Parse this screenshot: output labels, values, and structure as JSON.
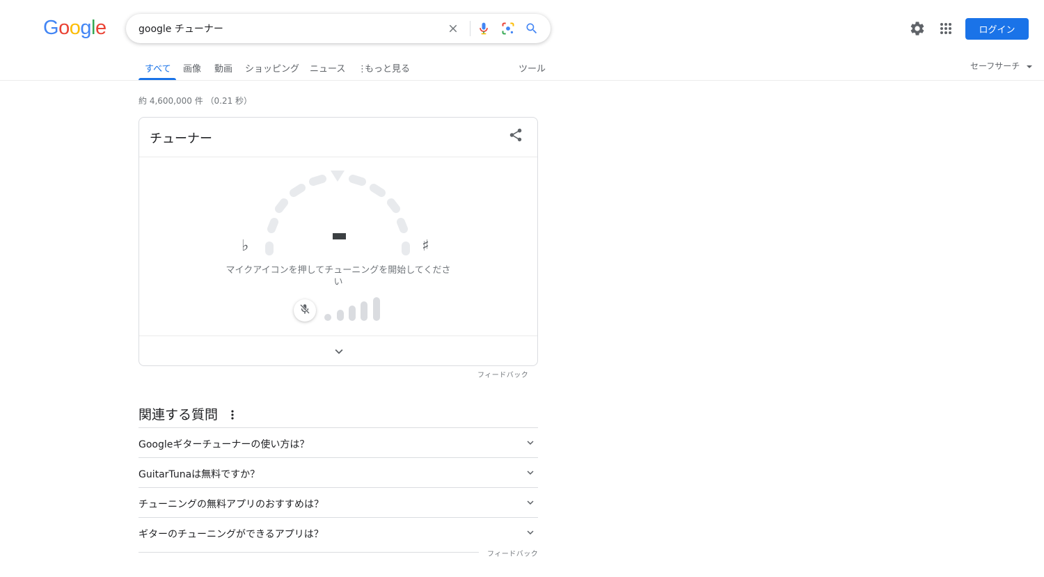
{
  "logo": {
    "letters": [
      {
        "ch": "G",
        "color": "#4285f4"
      },
      {
        "ch": "o",
        "color": "#ea4335"
      },
      {
        "ch": "o",
        "color": "#fbbc05"
      },
      {
        "ch": "g",
        "color": "#4285f4"
      },
      {
        "ch": "l",
        "color": "#34a853"
      },
      {
        "ch": "e",
        "color": "#ea4335"
      }
    ]
  },
  "search": {
    "value": "google チューナー",
    "clear_icon": "close-icon",
    "voice_icon": "mic-icon",
    "lens_icon": "lens-icon",
    "search_icon": "search-icon"
  },
  "header": {
    "settings_icon": "gear-icon",
    "apps_icon": "apps-grid-icon",
    "login_label": "ログイン"
  },
  "tabs": {
    "all": "すべて",
    "images": "画像",
    "videos": "動画",
    "shopping": "ショッピング",
    "news": "ニュース",
    "more": "もっと見る",
    "tools": "ツール",
    "safesearch": "セーフサーチ"
  },
  "result_stats": "約 4,600,000 件 （0.21 秒）",
  "tuner": {
    "title": "チューナー",
    "flat_symbol": "♭",
    "sharp_symbol": "♯",
    "note": "",
    "message": "マイクアイコンを押してチューニングを開始してください",
    "feedback": "フィードバック"
  },
  "paa": {
    "title": "関連する質問",
    "questions": [
      "Googleギターチューナーの使い方は？",
      "GuitarTunaは無料ですか？",
      "チューニングの無料アプリのおすすめは？",
      "ギターのチューニングができるアプリは？"
    ],
    "feedback": "フィードバック"
  },
  "colors": {
    "accent": "#1a73e8",
    "gauge_segment": "#e8eaed",
    "level_bar": "#dadce0"
  }
}
